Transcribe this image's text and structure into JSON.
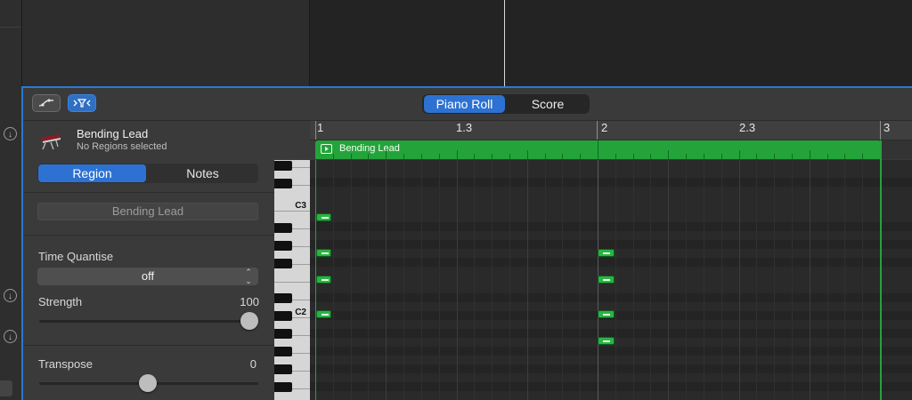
{
  "editor": {
    "tabs": [
      {
        "label": "Piano Roll",
        "selected": true
      },
      {
        "label": "Score",
        "selected": false
      }
    ]
  },
  "inspector": {
    "track_name": "Bending Lead",
    "track_status": "No Regions selected",
    "tabs": [
      {
        "label": "Region",
        "selected": true
      },
      {
        "label": "Notes",
        "selected": false
      }
    ],
    "region_name_field": "Bending Lead",
    "time_quantise": {
      "label": "Time Quantise",
      "value": "off"
    },
    "strength": {
      "label": "Strength",
      "value": "100",
      "level": 1.0
    },
    "transpose": {
      "label": "Transpose",
      "value": "0",
      "level": 0.5
    }
  },
  "keyboard": {
    "labels": [
      "C3",
      "C2"
    ]
  },
  "ruler": {
    "markers": [
      "1",
      "1.3",
      "2",
      "2.3",
      "3"
    ]
  },
  "region": {
    "title": "Bending Lead",
    "color": "#24a33b"
  },
  "colors": {
    "accent": "#2d72d2",
    "region_green": "#24a33b",
    "note_green": "#2ab443"
  },
  "icons": {
    "catch_button": "curve-icon",
    "filter_button": "funnel-filter-icon",
    "instrument": "keyboard-instrument-icon",
    "side_buttons": "arrow-down-circle-icon"
  }
}
